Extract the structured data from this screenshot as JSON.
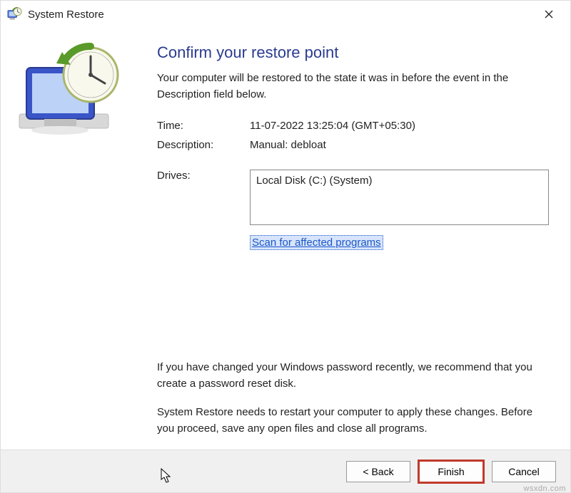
{
  "titlebar": {
    "title": "System Restore"
  },
  "heading": "Confirm your restore point",
  "description": "Your computer will be restored to the state it was in before the event in the Description field below.",
  "fields": {
    "time_label": "Time:",
    "time_value": "11-07-2022 13:25:04 (GMT+05:30)",
    "desc_label": "Description:",
    "desc_value": "Manual: debloat",
    "drives_label": "Drives:",
    "drives_value": "Local Disk (C:) (System)"
  },
  "scan_link": "Scan for affected programs",
  "notes": {
    "password": "If you have changed your Windows password recently, we recommend that you create a password reset disk.",
    "restart": "System Restore needs to restart your computer to apply these changes. Before you proceed, save any open files and close all programs."
  },
  "buttons": {
    "back": "< Back",
    "finish": "Finish",
    "cancel": "Cancel"
  },
  "watermark": "wsxdn.com"
}
